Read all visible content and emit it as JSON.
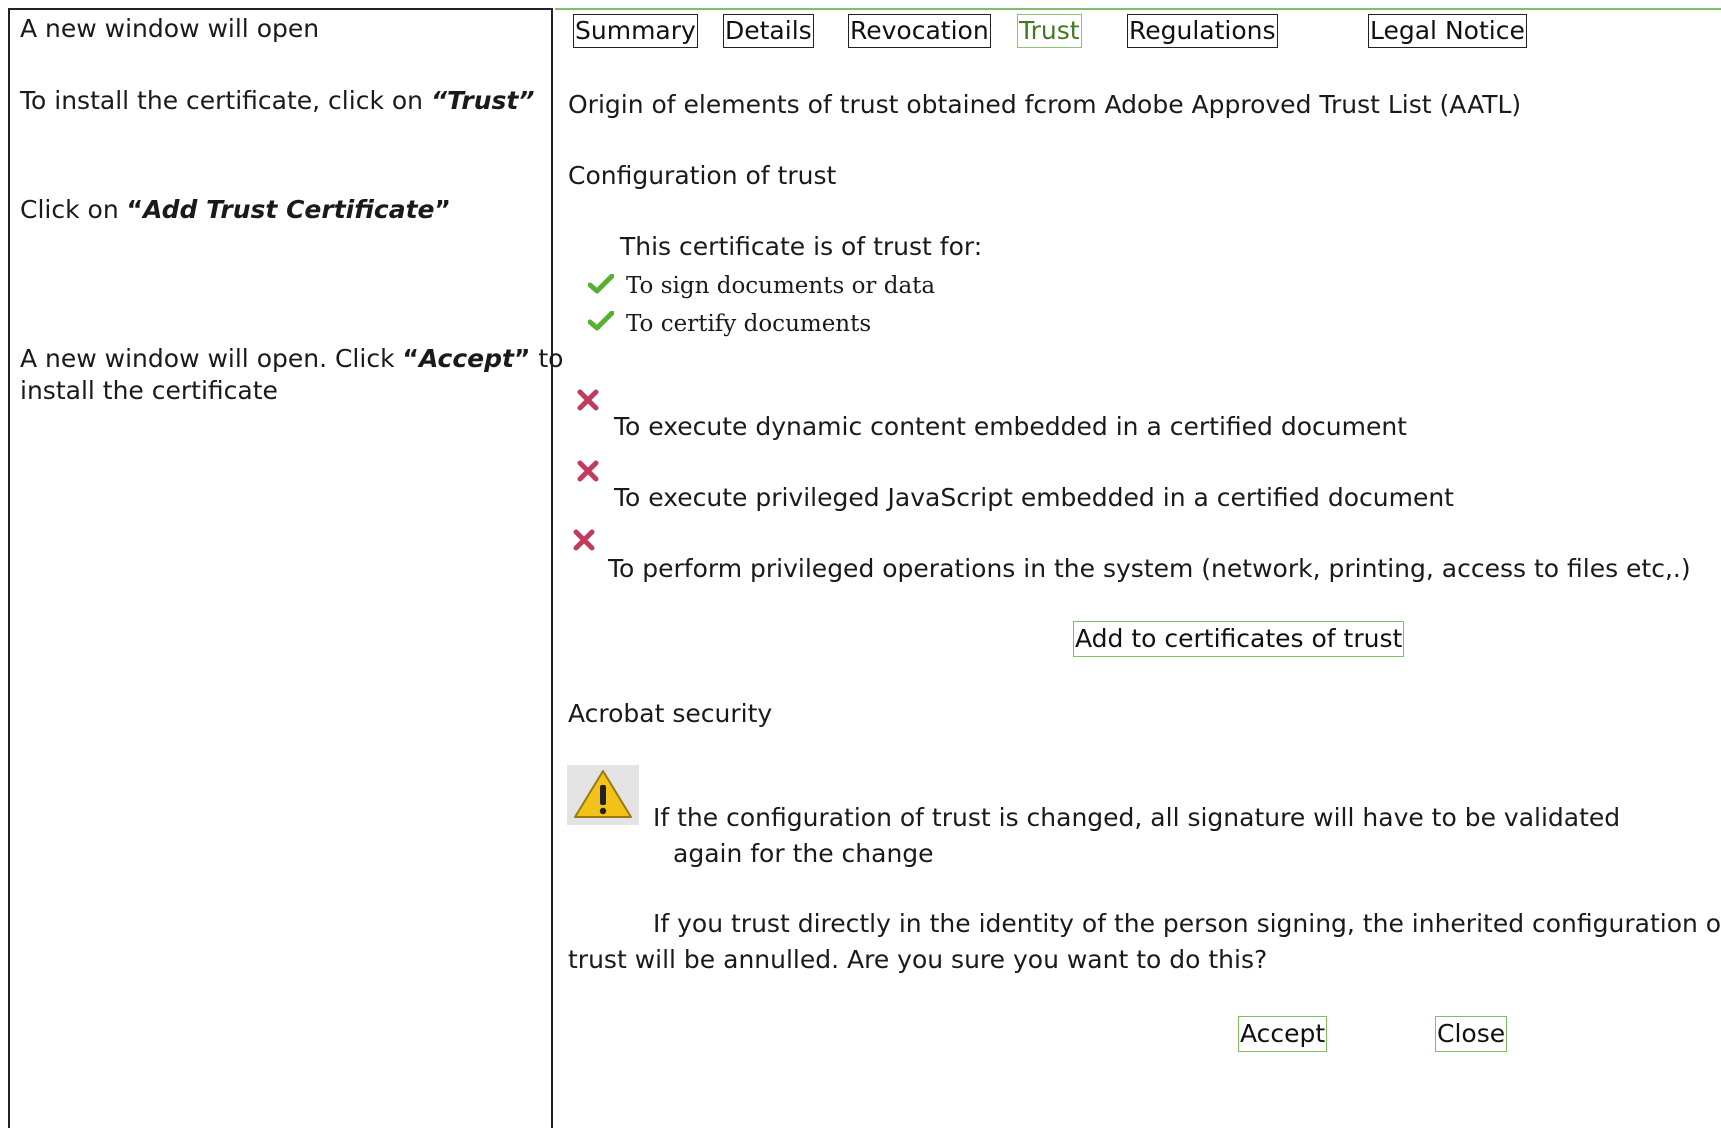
{
  "instructions": {
    "step1": "A new window will open",
    "step2_pre": "To install the certificate, click on ",
    "step2_em": "“Trust”",
    "step3_pre": "Click on  ",
    "step3_q1": "“",
    "step3_em": "Add Trust Certificate",
    "step3_q2": "”",
    "step4_pre": "A new window will open. Click ",
    "step4_q1": "“",
    "step4_em": "Accept",
    "step4_q2": "”",
    "step4_post": " to",
    "step4_line2": "install the certificate"
  },
  "tabs": {
    "summary": "Summary",
    "details": "Details",
    "revocation": "Revocation",
    "trust": "Trust",
    "regulations": "Regulations",
    "legal_notice": "Legal Notice"
  },
  "trust_panel": {
    "origin": "Origin of elements of trust obtained fcrom Adobe Approved Trust List (AATL)",
    "config_heading": "Configuration of trust",
    "trusted_for": "This certificate is of trust for:",
    "allowed": [
      "To sign documents or data",
      "To certify documents"
    ],
    "denied": [
      "To execute dynamic content embedded in a certified document",
      "To execute privileged JavaScript embedded in a certified document",
      "To perform privileged operations in the system (network, printing, access to files etc,.)"
    ],
    "add_button": "Add to certificates of trust",
    "security_heading": "Acrobat security",
    "warning_line1": "If the configuration of trust is changed, all signature will have to be validated",
    "warning_line2": "again for the change",
    "confirm_line1": "If you trust directly in the identity of the person signing, the inherited configuration of",
    "confirm_line2": "trust will be annulled. Are you sure you want to do this?",
    "accept_button": "Accept",
    "close_button": "Close"
  },
  "icons": {
    "check": "check-icon",
    "cross": "cross-icon",
    "warning": "warning-icon"
  },
  "colors": {
    "active_tab": "#3f7a1e",
    "button_border": "#7fbf5f",
    "check": "#59b030",
    "cross": "#c23a5c",
    "warning": "#f2c21b"
  }
}
